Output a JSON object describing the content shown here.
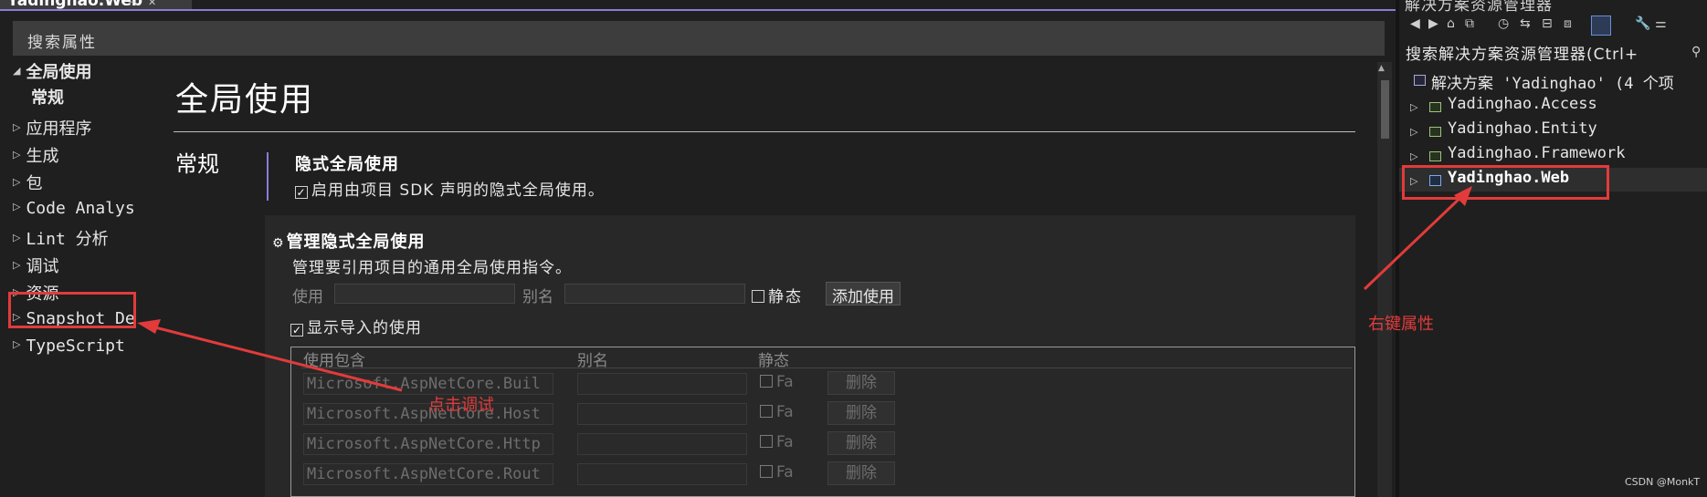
{
  "document": {
    "tab_label": "Yadinghao.Web",
    "search_placeholder": "搜索属性",
    "nav": {
      "global_usings": "全局使用",
      "general": "常规",
      "items": [
        "应用程序",
        "生成",
        "包",
        "Code Analys",
        "Lint 分析",
        "调试",
        "资源",
        "Snapshot De",
        "TypeScript"
      ]
    },
    "page_title": "全局使用",
    "section_label": "常规",
    "implicit": {
      "title": "隐式全局使用",
      "checkbox_label": "启用由项目 SDK 声明的隐式全局使用。",
      "checked": true
    },
    "manage": {
      "title": "管理隐式全局使用",
      "description": "管理要引用项目的通用全局使用指令。",
      "using_label": "使用",
      "alias_label": "别名",
      "static_label": "静态",
      "add_button": "添加使用",
      "show_imported_label": "显示导入的使用",
      "show_imported_checked": true,
      "columns": [
        "使用包含",
        "别名",
        "静态"
      ],
      "rows": [
        {
          "namespace": "Microsoft.AspNetCore.Buil",
          "alias": "",
          "static_label": "Fa",
          "delete": "删除"
        },
        {
          "namespace": "Microsoft.AspNetCore.Host",
          "alias": "",
          "static_label": "Fa",
          "delete": "删除"
        },
        {
          "namespace": "Microsoft.AspNetCore.Http",
          "alias": "",
          "static_label": "Fa",
          "delete": "删除"
        },
        {
          "namespace": "Microsoft.AspNetCore.Rout",
          "alias": "",
          "static_label": "Fa",
          "delete": "删除"
        }
      ]
    }
  },
  "solution_explorer": {
    "title": "解决方案资源管理器",
    "search_label": "搜索解决方案资源管理器(Ctrl+",
    "solution_row": "解决方案 'Yadinghao' (4 个项",
    "projects": [
      "Yadinghao.Access",
      "Yadinghao.Entity",
      "Yadinghao.Framework",
      "Yadinghao.Web"
    ],
    "selected_project": "Yadinghao.Web"
  },
  "annotations": {
    "click_debug": "点击调试",
    "right_click_properties": "右键属性",
    "watermark": "CSDN @MonkT"
  },
  "colors": {
    "background": "#1f1f1f",
    "accent": "#8d7bd6",
    "annotation_red": "#e23b3b"
  },
  "icons": [
    "pin-icon",
    "close-icon",
    "home-icon",
    "refresh-icon",
    "collapse-icon",
    "wrench-icon",
    "search-icon",
    "expand-arrow-icon",
    "gear-icon"
  ]
}
